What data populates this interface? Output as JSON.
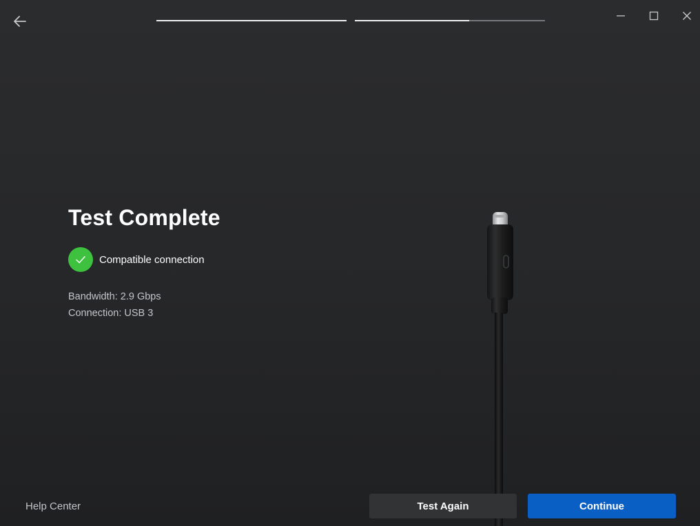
{
  "header": {
    "progress_steps": [
      {
        "name": "step-1",
        "fraction": 1.0
      },
      {
        "name": "step-2",
        "fraction": 0.6
      }
    ]
  },
  "main": {
    "title": "Test Complete",
    "status_text": "Compatible connection",
    "bandwidth": "Bandwidth: 2.9 Gbps",
    "connection": "Connection: USB 3"
  },
  "footer": {
    "help_link": "Help Center",
    "test_again_label": "Test Again",
    "continue_label": "Continue"
  },
  "icons": {
    "back": "arrow-left-icon",
    "minimize": "minimize-icon",
    "maximize": "maximize-icon",
    "close": "close-icon",
    "status": "check-icon"
  },
  "colors": {
    "accent": "#0a5fc4",
    "success": "#3ec13e",
    "background": "#2b2c2e"
  }
}
